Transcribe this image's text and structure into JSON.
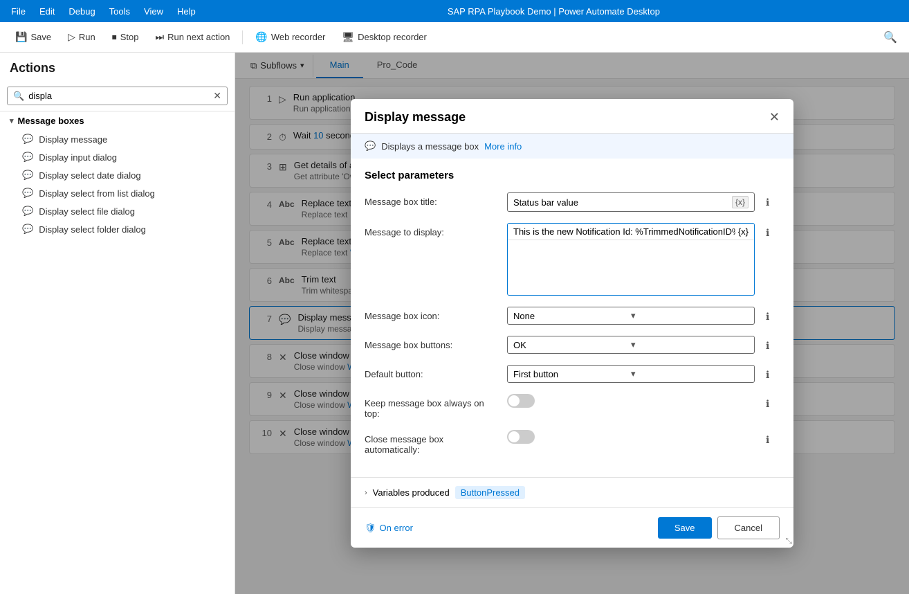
{
  "app": {
    "title": "SAP RPA Playbook Demo | Power Automate Desktop"
  },
  "menu": {
    "items": [
      "File",
      "Edit",
      "Debug",
      "Tools",
      "View",
      "Help"
    ]
  },
  "toolbar": {
    "save_label": "Save",
    "run_label": "Run",
    "stop_label": "Stop",
    "run_next_label": "Run next action",
    "web_recorder_label": "Web recorder",
    "desktop_recorder_label": "Desktop recorder"
  },
  "sidebar": {
    "title": "Actions",
    "search_placeholder": "displa",
    "search_value": "displa",
    "category": "Message boxes",
    "actions": [
      "Display message",
      "Display input dialog",
      "Display select date dialog",
      "Display select from list dialog",
      "Display select file dialog",
      "Display select folder dialog"
    ]
  },
  "tabs": {
    "subflows_label": "Subflows",
    "tabs": [
      {
        "label": "Main",
        "active": true
      },
      {
        "label": "Pro_Code",
        "active": false
      }
    ]
  },
  "flow": {
    "steps": [
      {
        "num": "1",
        "icon": "▷",
        "title": "Run application",
        "desc": "Run application 'C:\\Program Files (x86)\\SAP\\FrontEnd\\SapGui\\sapshcut.exe' with arguments 'start -system=\" SAPSystemId \" -client=\" SAPClient -us"
      },
      {
        "num": "2",
        "icon": "⏱",
        "title": "Wait 10 seconds",
        "desc": ""
      },
      {
        "num": "3",
        "icon": "⊞",
        "title": "Get details of a UI ele",
        "desc": "Get attribute 'Own Text' o"
      },
      {
        "num": "4",
        "icon": "Abc",
        "title": "Replace text",
        "desc": "Replace text  AttributeVa"
      },
      {
        "num": "5",
        "icon": "Abc",
        "title": "Replace text",
        "desc": "Replace text 'saved' with '"
      },
      {
        "num": "6",
        "icon": "Abc",
        "title": "Trim text",
        "desc": "Trim whitespace characte"
      },
      {
        "num": "7",
        "icon": "💬",
        "title": "Display message",
        "desc": "Display message 'This is t"
      },
      {
        "num": "8",
        "icon": "✕",
        "title": "Close window",
        "desc": "Close window Window 'S"
      },
      {
        "num": "9",
        "icon": "✕",
        "title": "Close window",
        "desc": "Close window Window 'S"
      },
      {
        "num": "10",
        "icon": "✕",
        "title": "Close window",
        "desc": "Close window Window 'S"
      }
    ]
  },
  "modal": {
    "title": "Display message",
    "close_label": "✕",
    "info_text": "Displays a message box",
    "more_info_label": "More info",
    "section_title": "Select parameters",
    "params": {
      "message_box_title_label": "Message box title:",
      "message_box_title_value": "Status bar value",
      "message_to_display_label": "Message to display:",
      "message_to_display_value": "This is the new Notification Id: %TrimmedNotificationID%",
      "message_box_icon_label": "Message box icon:",
      "message_box_icon_value": "None",
      "message_box_buttons_label": "Message box buttons:",
      "message_box_buttons_value": "OK",
      "default_button_label": "Default button:",
      "default_button_value": "First button",
      "keep_on_top_label": "Keep message box always on top:",
      "keep_on_top_value": false,
      "close_automatically_label": "Close message box automatically:",
      "close_automatically_value": false
    },
    "variables_label": "Variables produced",
    "variable_badge": "ButtonPressed",
    "on_error_label": "On error",
    "save_label": "Save",
    "cancel_label": "Cancel"
  }
}
